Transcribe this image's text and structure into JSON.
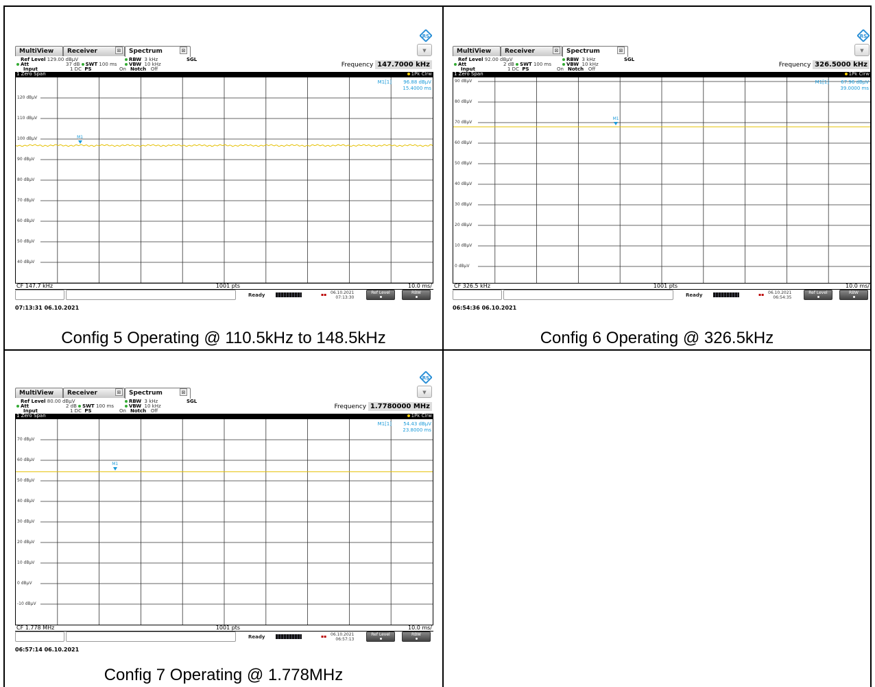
{
  "screens": [
    {
      "tabs": [
        "MultiView",
        "Receiver",
        "Spectrum"
      ],
      "ref_level_label": "Ref Level",
      "ref_level": "129.00 dBµV",
      "att_label": "Att",
      "att": "37 dB",
      "swt_label": "SWT",
      "swt": "100 ms",
      "input_label": "Input",
      "input": "1 DC",
      "ps_label": "PS",
      "ps": "On",
      "rbw_label": "RBW",
      "rbw": "3 kHz",
      "vbw_label": "VBW",
      "vbw": "10 kHz",
      "notch_label": "Notch",
      "notch": "Off",
      "mode": "SGL",
      "frequency_label": "Frequency",
      "frequency": "147.7000 kHz",
      "window_title": "1 Zero Span",
      "trace_label": "1Pk Clrw",
      "marker_name": "M1[1]",
      "marker_level": "96.88 dBµV",
      "marker_time": "15.4000 ms",
      "marker_tag": "M1",
      "y_ticks": [
        "120 dBµV",
        "110 dBµV",
        "100 dBµV",
        "90 dBµV",
        "80 dBµV",
        "70 dBµV",
        "60 dBµV",
        "50 dBµV",
        "40 dBµV"
      ],
      "cf": "CF 147.7 kHz",
      "points": "1001 pts",
      "div": "10.0 ms/",
      "status": "Ready",
      "date": "06.10.2021",
      "time": "07:13:30",
      "btn1": "Ref Level",
      "btn2": "RBW",
      "timestamp": "07:13:31 06.10.2021",
      "chart_data": {
        "type": "line",
        "ylim": [
          30,
          130
        ],
        "x_range_ms": [
          0,
          100
        ],
        "trace_level": 96.88,
        "marker_x_ms": 15.4,
        "trace_color": "#e5c000",
        "noisy": true,
        "gridlines_y": [
          30,
          40,
          50,
          60,
          70,
          80,
          90,
          100,
          110,
          120
        ]
      }
    },
    {
      "tabs": [
        "MultiView",
        "Receiver",
        "Spectrum"
      ],
      "ref_level_label": "Ref Level",
      "ref_level": "92.00 dBµV",
      "att_label": "Att",
      "att": "2 dB",
      "swt_label": "SWT",
      "swt": "100 ms",
      "input_label": "Input",
      "input": "1 DC",
      "ps_label": "PS",
      "ps": "On",
      "rbw_label": "RBW",
      "rbw": "3 kHz",
      "vbw_label": "VBW",
      "vbw": "10 kHz",
      "notch_label": "Notch",
      "notch": "Off",
      "mode": "SGL",
      "frequency_label": "Frequency",
      "frequency": "326.5000 kHz",
      "window_title": "1 Zero Span",
      "trace_label": "1Pk Clrw",
      "marker_name": "M1[1]",
      "marker_level": "67.96 dBµV",
      "marker_time": "39.0000 ms",
      "marker_tag": "M1",
      "y_ticks": [
        "90 dBµV",
        "80 dBµV",
        "70 dBµV",
        "60 dBµV",
        "50 dBµV",
        "40 dBµV",
        "30 dBµV",
        "20 dBµV",
        "10 dBµV",
        "0 dBµV"
      ],
      "cf": "CF 326.5 kHz",
      "points": "1001 pts",
      "div": "10.0 ms/",
      "status": "Ready",
      "date": "06.10.2021",
      "time": "06:54:35",
      "btn1": "Ref Level",
      "btn2": "RBW",
      "timestamp": "06:54:36 06.10.2021",
      "chart_data": {
        "type": "line",
        "ylim": [
          -8,
          92
        ],
        "x_range_ms": [
          0,
          100
        ],
        "trace_level": 67.96,
        "marker_x_ms": 39.0,
        "trace_color": "#e5c000",
        "noisy": false,
        "gridlines_y": [
          0,
          10,
          20,
          30,
          40,
          50,
          60,
          70,
          80,
          90
        ]
      }
    },
    {
      "tabs": [
        "MultiView",
        "Receiver",
        "Spectrum"
      ],
      "ref_level_label": "Ref Level",
      "ref_level": "80.00 dBµV",
      "att_label": "Att",
      "att": "2 dB",
      "swt_label": "SWT",
      "swt": "100 ms",
      "input_label": "Input",
      "input": "1 DC",
      "ps_label": "PS",
      "ps": "On",
      "rbw_label": "RBW",
      "rbw": "3 kHz",
      "vbw_label": "VBW",
      "vbw": "10 kHz",
      "notch_label": "Notch",
      "notch": "Off",
      "mode": "SGL",
      "frequency_label": "Frequency",
      "frequency": "1.7780000 MHz",
      "window_title": "1 Zero Span",
      "trace_label": "1Pk Clrw",
      "marker_name": "M1[1]",
      "marker_level": "54.43 dBµV",
      "marker_time": "23.8000 ms",
      "marker_tag": "M1",
      "y_ticks": [
        "70 dBµV",
        "60 dBµV",
        "50 dBµV",
        "40 dBµV",
        "30 dBµV",
        "20 dBµV",
        "10 dBµV",
        "0 dBµV",
        "-10 dBµV"
      ],
      "cf": "CF 1.778 MHz",
      "points": "1001 pts",
      "div": "10.0 ms/",
      "status": "Ready",
      "date": "06.10.2021",
      "time": "06:57:13",
      "btn1": "Ref Level",
      "btn2": "RBW",
      "timestamp": "06:57:14 06.10.2021",
      "chart_data": {
        "type": "line",
        "ylim": [
          -20,
          80
        ],
        "x_range_ms": [
          0,
          100
        ],
        "trace_level": 54.43,
        "marker_x_ms": 23.8,
        "trace_color": "#e5c000",
        "noisy": false,
        "gridlines_y": [
          -10,
          0,
          10,
          20,
          30,
          40,
          50,
          60,
          70
        ]
      }
    }
  ],
  "captions": [
    "Config 5 Operating @ 110.5kHz to 148.5kHz",
    "Config 6 Operating @ 326.5kHz",
    "Config 7 Operating @ 1.778MHz"
  ]
}
